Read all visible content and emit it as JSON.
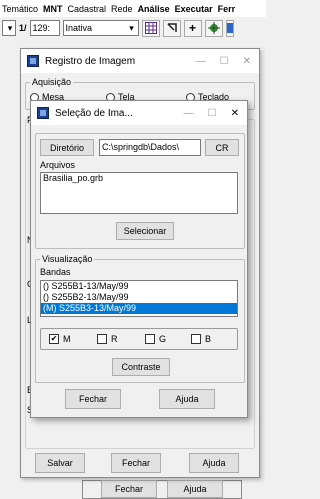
{
  "menubar": {
    "items": [
      "Temático",
      "MNT",
      "Cadastral",
      "Rede",
      "Análise",
      "Executar",
      "Ferr"
    ]
  },
  "toolbar": {
    "scale_prefix": "1/",
    "scale_value": "129:",
    "mode_value": "Inativa"
  },
  "registro_window": {
    "title": "Registro de Imagem",
    "aquisicao_label": "Aquisição",
    "radio_mesa": "Mesa",
    "radio_tela": "Tela",
    "radio_teclado": "Teclado",
    "partial_p": "P",
    "partial_n": "N",
    "partial_c": "C",
    "partial_l": "L",
    "partial_e": "E",
    "partial_s": "S",
    "salvar_label": "Salvar",
    "fechar_label": "Fechar",
    "ajuda_label": "Ajuda"
  },
  "behind_window": {
    "fechar_label": "Fechar",
    "ajuda_label": "Ajuda"
  },
  "selecao_dialog": {
    "title": "Seleção de Ima...",
    "diretorio_button": "Diretório",
    "path_value": "C:\\springdb\\Dados\\",
    "cr_button": "CR",
    "arquivos_label": "Arquivos",
    "files": [
      "Brasilia_po.grb"
    ],
    "selecionar_button": "Selecionar",
    "visualizacao_label": "Visualização",
    "bandas_label": "Bandas",
    "bands": [
      {
        "text": "() S255B1-13/May/99",
        "selected": false
      },
      {
        "text": "() S255B2-13/May/99",
        "selected": false
      },
      {
        "text": "(M) S255B3-13/May/99",
        "selected": true
      }
    ],
    "checks": [
      {
        "label": "M",
        "checked": true
      },
      {
        "label": "R",
        "checked": false
      },
      {
        "label": "G",
        "checked": false
      },
      {
        "label": "B",
        "checked": false
      }
    ],
    "checkmark": "✔",
    "contraste_button": "Contraste",
    "fechar_button": "Fechar",
    "ajuda_button": "Ajuda"
  }
}
